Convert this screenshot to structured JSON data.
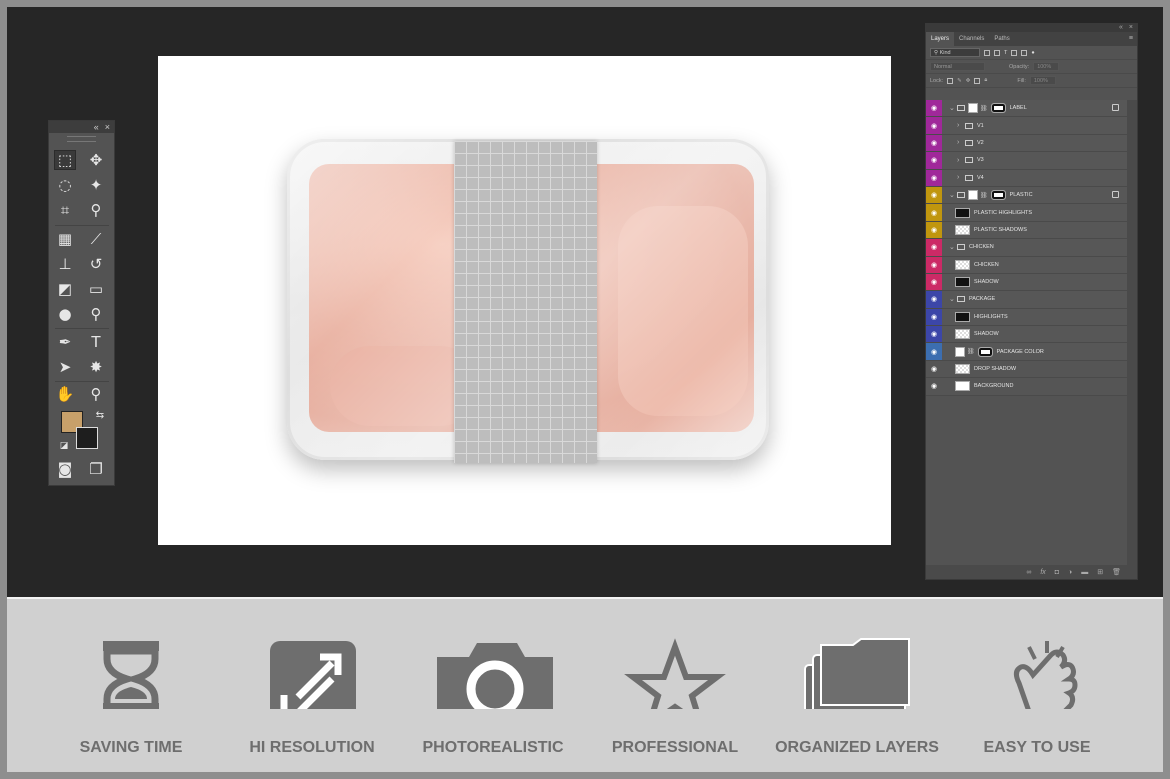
{
  "toolbox": {
    "header_icons": [
      "collapse-icon",
      "close-icon"
    ],
    "tools": [
      "rectangular-marquee-icon",
      "move-icon",
      "lasso-icon",
      "magic-wand-icon",
      "crop-icon",
      "eyedropper-icon",
      "healing-brush-icon",
      "brush-icon",
      "clone-stamp-icon",
      "history-brush-icon",
      "eraser-icon",
      "gradient-icon",
      "blur-icon",
      "dodge-icon",
      "pen-icon",
      "type-icon",
      "path-selection-icon",
      "shape-icon",
      "hand-icon",
      "zoom-icon",
      "quick-mask-icon",
      "screen-mode-icon"
    ],
    "foreground_color": "#c7a06a",
    "background_color": "#1e1e1e"
  },
  "layers_panel": {
    "tabs": [
      "Layers",
      "Channels",
      "Paths"
    ],
    "filter_kind": "Kind",
    "blend_mode": "Normal",
    "opacity_label": "Opacity:",
    "opacity_value": "100%",
    "lock_label": "Lock:",
    "fill_label": "Fill:",
    "fill_value": "100%",
    "layers": [
      {
        "name": "LABEL",
        "color": "#a0289a",
        "type": "group-mask"
      },
      {
        "name": "V1",
        "color": "#a0289a",
        "type": "subgroup"
      },
      {
        "name": "V2",
        "color": "#a0289a",
        "type": "subgroup"
      },
      {
        "name": "V3",
        "color": "#a0289a",
        "type": "subgroup"
      },
      {
        "name": "V4",
        "color": "#a0289a",
        "type": "subgroup"
      },
      {
        "name": "PLASTIC",
        "color": "#c0960e",
        "type": "group-mask"
      },
      {
        "name": "PLASTIC HIGHLIGHTS",
        "color": "#c0960e",
        "type": "layer-dark"
      },
      {
        "name": "PLASTIC SHADOWS",
        "color": "#c0960e",
        "type": "layer-checker"
      },
      {
        "name": "CHICKEN",
        "color": "#cc2a66",
        "type": "group"
      },
      {
        "name": "CHICKEN",
        "color": "#cc2a66",
        "type": "layer-checker"
      },
      {
        "name": "SHADOW",
        "color": "#cc2a66",
        "type": "layer-dark"
      },
      {
        "name": "PACKAGE",
        "color": "#3c46a8",
        "type": "group"
      },
      {
        "name": "HIGHLIGHTS",
        "color": "#3c46a8",
        "type": "layer-dark"
      },
      {
        "name": "SHADOW",
        "color": "#3c46a8",
        "type": "layer-checker"
      },
      {
        "name": "PACKAGE COLOR",
        "color": "#3c6eb0",
        "type": "layer-mask"
      },
      {
        "name": "DROP SHADOW",
        "color": "",
        "type": "layer-checker"
      },
      {
        "name": "BACKGROUND",
        "color": "",
        "type": "layer-white"
      }
    ]
  },
  "features": [
    {
      "label": "SAVING TIME",
      "icon": "hourglass-icon"
    },
    {
      "label": "HI RESOLUTION",
      "icon": "expand-arrows-icon"
    },
    {
      "label": "PHOTOREALISTIC",
      "icon": "camera-icon"
    },
    {
      "label": "PROFESSIONAL",
      "icon": "star-icon"
    },
    {
      "label": "ORGANIZED LAYERS",
      "icon": "folders-icon"
    },
    {
      "label": "EASY TO USE",
      "icon": "tap-hand-icon"
    }
  ]
}
